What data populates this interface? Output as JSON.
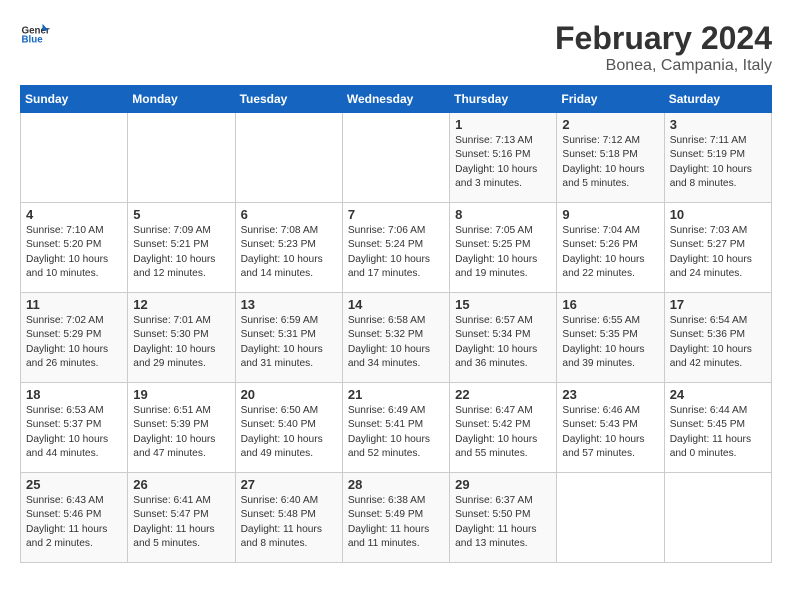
{
  "header": {
    "logo_general": "General",
    "logo_blue": "Blue",
    "month_year": "February 2024",
    "location": "Bonea, Campania, Italy"
  },
  "days_of_week": [
    "Sunday",
    "Monday",
    "Tuesday",
    "Wednesday",
    "Thursday",
    "Friday",
    "Saturday"
  ],
  "weeks": [
    [
      {
        "day": "",
        "info": ""
      },
      {
        "day": "",
        "info": ""
      },
      {
        "day": "",
        "info": ""
      },
      {
        "day": "",
        "info": ""
      },
      {
        "day": "1",
        "info": "Sunrise: 7:13 AM\nSunset: 5:16 PM\nDaylight: 10 hours\nand 3 minutes."
      },
      {
        "day": "2",
        "info": "Sunrise: 7:12 AM\nSunset: 5:18 PM\nDaylight: 10 hours\nand 5 minutes."
      },
      {
        "day": "3",
        "info": "Sunrise: 7:11 AM\nSunset: 5:19 PM\nDaylight: 10 hours\nand 8 minutes."
      }
    ],
    [
      {
        "day": "4",
        "info": "Sunrise: 7:10 AM\nSunset: 5:20 PM\nDaylight: 10 hours\nand 10 minutes."
      },
      {
        "day": "5",
        "info": "Sunrise: 7:09 AM\nSunset: 5:21 PM\nDaylight: 10 hours\nand 12 minutes."
      },
      {
        "day": "6",
        "info": "Sunrise: 7:08 AM\nSunset: 5:23 PM\nDaylight: 10 hours\nand 14 minutes."
      },
      {
        "day": "7",
        "info": "Sunrise: 7:06 AM\nSunset: 5:24 PM\nDaylight: 10 hours\nand 17 minutes."
      },
      {
        "day": "8",
        "info": "Sunrise: 7:05 AM\nSunset: 5:25 PM\nDaylight: 10 hours\nand 19 minutes."
      },
      {
        "day": "9",
        "info": "Sunrise: 7:04 AM\nSunset: 5:26 PM\nDaylight: 10 hours\nand 22 minutes."
      },
      {
        "day": "10",
        "info": "Sunrise: 7:03 AM\nSunset: 5:27 PM\nDaylight: 10 hours\nand 24 minutes."
      }
    ],
    [
      {
        "day": "11",
        "info": "Sunrise: 7:02 AM\nSunset: 5:29 PM\nDaylight: 10 hours\nand 26 minutes."
      },
      {
        "day": "12",
        "info": "Sunrise: 7:01 AM\nSunset: 5:30 PM\nDaylight: 10 hours\nand 29 minutes."
      },
      {
        "day": "13",
        "info": "Sunrise: 6:59 AM\nSunset: 5:31 PM\nDaylight: 10 hours\nand 31 minutes."
      },
      {
        "day": "14",
        "info": "Sunrise: 6:58 AM\nSunset: 5:32 PM\nDaylight: 10 hours\nand 34 minutes."
      },
      {
        "day": "15",
        "info": "Sunrise: 6:57 AM\nSunset: 5:34 PM\nDaylight: 10 hours\nand 36 minutes."
      },
      {
        "day": "16",
        "info": "Sunrise: 6:55 AM\nSunset: 5:35 PM\nDaylight: 10 hours\nand 39 minutes."
      },
      {
        "day": "17",
        "info": "Sunrise: 6:54 AM\nSunset: 5:36 PM\nDaylight: 10 hours\nand 42 minutes."
      }
    ],
    [
      {
        "day": "18",
        "info": "Sunrise: 6:53 AM\nSunset: 5:37 PM\nDaylight: 10 hours\nand 44 minutes."
      },
      {
        "day": "19",
        "info": "Sunrise: 6:51 AM\nSunset: 5:39 PM\nDaylight: 10 hours\nand 47 minutes."
      },
      {
        "day": "20",
        "info": "Sunrise: 6:50 AM\nSunset: 5:40 PM\nDaylight: 10 hours\nand 49 minutes."
      },
      {
        "day": "21",
        "info": "Sunrise: 6:49 AM\nSunset: 5:41 PM\nDaylight: 10 hours\nand 52 minutes."
      },
      {
        "day": "22",
        "info": "Sunrise: 6:47 AM\nSunset: 5:42 PM\nDaylight: 10 hours\nand 55 minutes."
      },
      {
        "day": "23",
        "info": "Sunrise: 6:46 AM\nSunset: 5:43 PM\nDaylight: 10 hours\nand 57 minutes."
      },
      {
        "day": "24",
        "info": "Sunrise: 6:44 AM\nSunset: 5:45 PM\nDaylight: 11 hours\nand 0 minutes."
      }
    ],
    [
      {
        "day": "25",
        "info": "Sunrise: 6:43 AM\nSunset: 5:46 PM\nDaylight: 11 hours\nand 2 minutes."
      },
      {
        "day": "26",
        "info": "Sunrise: 6:41 AM\nSunset: 5:47 PM\nDaylight: 11 hours\nand 5 minutes."
      },
      {
        "day": "27",
        "info": "Sunrise: 6:40 AM\nSunset: 5:48 PM\nDaylight: 11 hours\nand 8 minutes."
      },
      {
        "day": "28",
        "info": "Sunrise: 6:38 AM\nSunset: 5:49 PM\nDaylight: 11 hours\nand 11 minutes."
      },
      {
        "day": "29",
        "info": "Sunrise: 6:37 AM\nSunset: 5:50 PM\nDaylight: 11 hours\nand 13 minutes."
      },
      {
        "day": "",
        "info": ""
      },
      {
        "day": "",
        "info": ""
      }
    ]
  ]
}
